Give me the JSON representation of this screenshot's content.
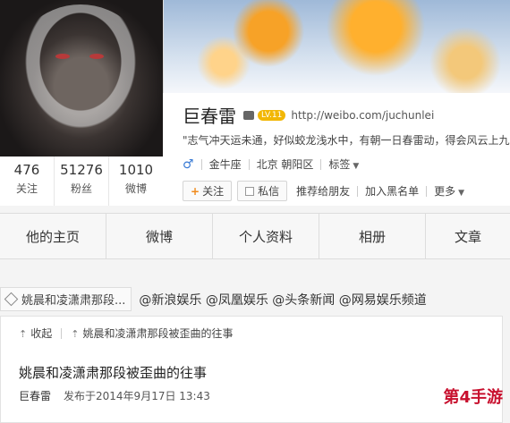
{
  "profile": {
    "name": "巨春雷",
    "level": "LV.11",
    "url": "http://weibo.com/juchunlei",
    "motto": "\"志气冲天运未通，好似蛟龙浅水中，有朝一日春雷动，得会风云上九",
    "gender_symbol": "♂",
    "zodiac": "金牛座",
    "location": "北京 朝阳区",
    "tags_label": "标签"
  },
  "stats": [
    {
      "num": "476",
      "label": "关注"
    },
    {
      "num": "51276",
      "label": "粉丝"
    },
    {
      "num": "1010",
      "label": "微博"
    }
  ],
  "actions": {
    "follow": "关注",
    "message": "私信",
    "recommend": "推荐给朋友",
    "blacklist": "加入黑名单",
    "more": "更多"
  },
  "tabs": [
    "他的主页",
    "微博",
    "个人资料",
    "相册",
    "文章"
  ],
  "share": {
    "tag": "姚晨和凌潇肃那段...",
    "mentions": "@新浪娱乐 @凤凰娱乐 @头条新闻 @网易娱乐频道"
  },
  "article": {
    "collapse": "收起",
    "breadcrumb": "姚晨和凌潇肃那段被歪曲的往事",
    "title": "姚晨和凌潇肃那段被歪曲的往事",
    "author": "巨春雷",
    "published": "发布于2014年9月17日 13:43"
  },
  "watermark": "第4手游",
  "colors": {
    "accent": "#f08a1b",
    "link": "#3a7bd5",
    "watermark": "#c8102e"
  }
}
